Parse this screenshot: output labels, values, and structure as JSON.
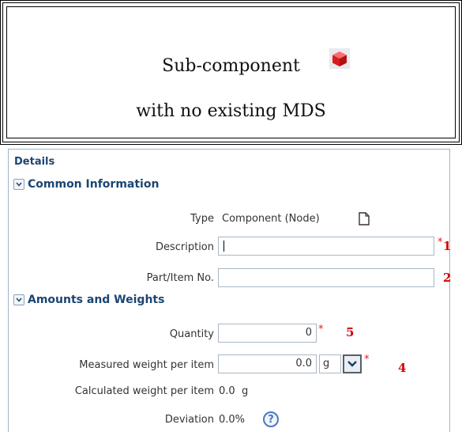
{
  "title_box": {
    "line1": "Sub-component",
    "line2": "with no existing MDS",
    "icon": "red-cube-icon"
  },
  "details": {
    "title": "Details",
    "common_info": {
      "header": "Common Information",
      "type_label": "Type",
      "type_value": "Component (Node)",
      "type_icon": "document-icon",
      "description_label": "Description",
      "description_value": "",
      "part_label": "Part/Item No.",
      "part_value": ""
    },
    "amounts": {
      "header": "Amounts and Weights",
      "quantity_label": "Quantity",
      "quantity_value": "0",
      "measured_label": "Measured weight per item",
      "measured_value": "0.0",
      "measured_unit": "g",
      "calculated_label": "Calculated weight per item",
      "calculated_value": "0.0  g",
      "deviation_label": "Deviation",
      "deviation_value": "0.0%",
      "help_icon": "help-icon"
    }
  },
  "markers": {
    "required": "*",
    "description_num": "1",
    "part_num": "2",
    "quantity_num": "5",
    "measured_num": "4"
  },
  "colors": {
    "header_text": "#1c4572",
    "required": "#e02020",
    "marker": "#d40000",
    "panel_border": "#9fb4cc"
  }
}
